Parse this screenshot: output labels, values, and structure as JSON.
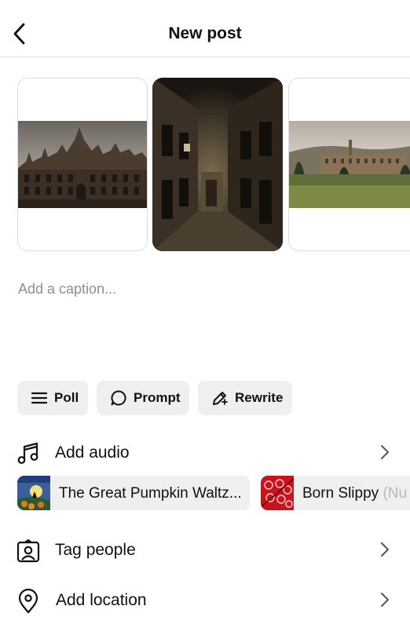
{
  "header": {
    "title": "New post",
    "back_icon": "chevron-left-icon"
  },
  "media": [
    {
      "name": "gothic-building-photo"
    },
    {
      "name": "ruined-corridor-photo"
    },
    {
      "name": "hillside-building-photo"
    }
  ],
  "caption": {
    "placeholder": "Add a caption..."
  },
  "actions": {
    "poll": "Poll",
    "prompt": "Prompt",
    "rewrite": "Rewrite"
  },
  "audio": {
    "label": "Add audio",
    "icon": "music-note-icon",
    "tracks": [
      {
        "title": "The Great Pumpkin Waltz..."
      },
      {
        "title": "Born Slippy",
        "title_faded": "(Nu"
      }
    ]
  },
  "tag_people": {
    "label": "Tag people",
    "icon": "tag-person-icon"
  },
  "location": {
    "label": "Add location",
    "icon": "location-pin-icon"
  },
  "colors": {
    "placeholder": "#8e8e8e",
    "pill_bg": "#efefef",
    "divider": "#dbdbdb"
  }
}
